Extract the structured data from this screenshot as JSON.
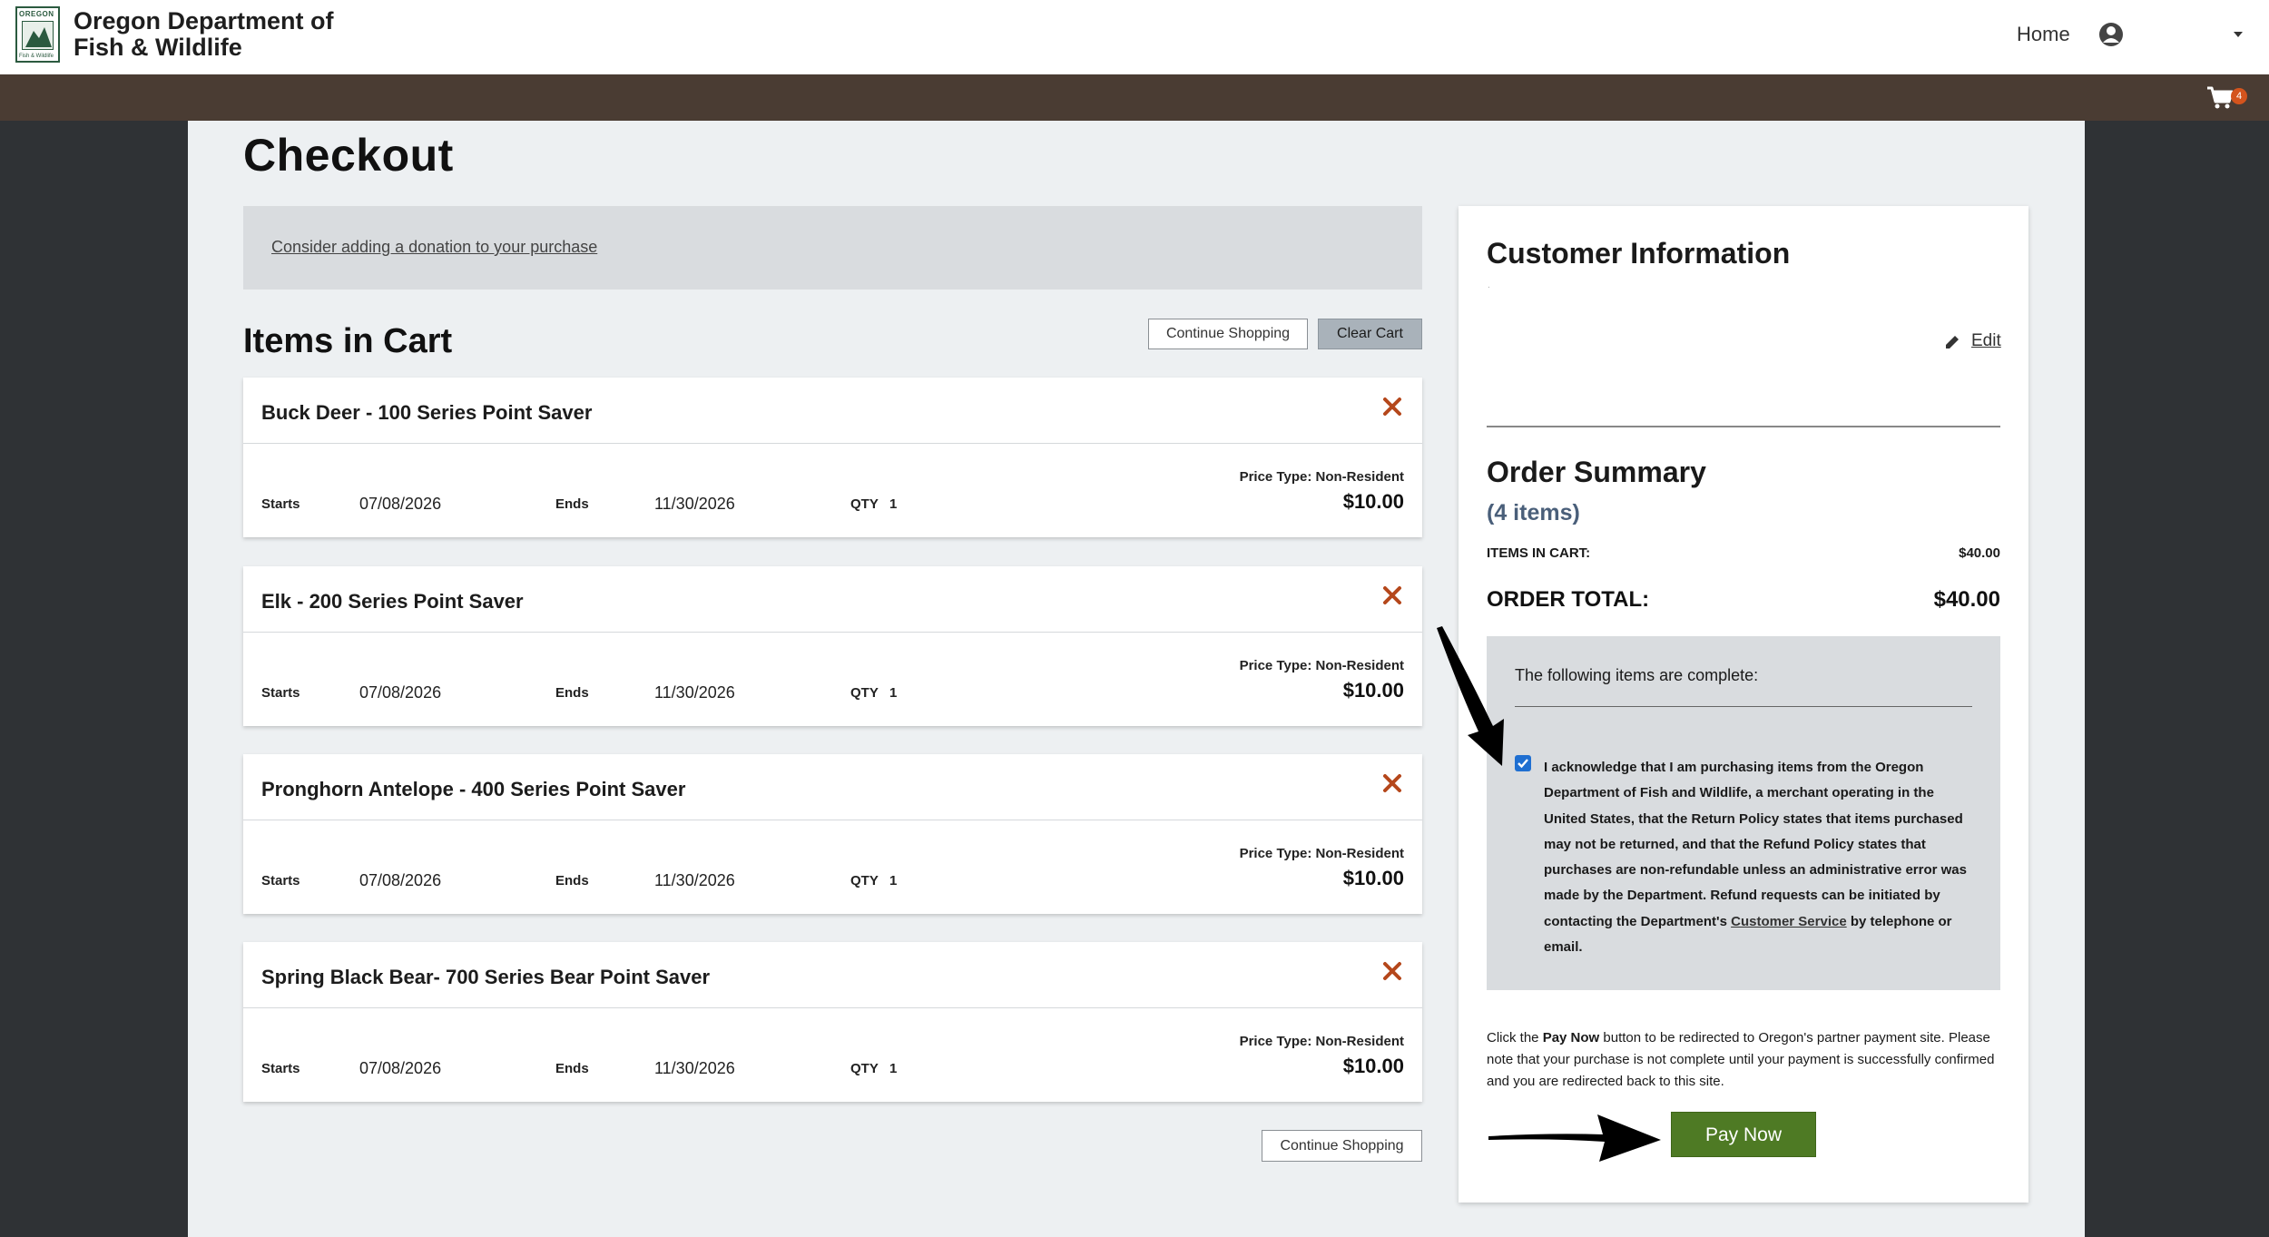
{
  "header": {
    "org_name": "Oregon Department of Fish & Wildlife",
    "logo_top": "OREGON",
    "logo_bottom": "Fish & Wildlife",
    "nav_home": "Home",
    "cart_count": "4"
  },
  "page": {
    "title": "Checkout",
    "donation_link": "Consider adding a donation to your purchase",
    "items_title": "Items in Cart",
    "continue_shopping": "Continue Shopping",
    "clear_cart": "Clear Cart"
  },
  "field_labels": {
    "starts": "Starts",
    "ends": "Ends",
    "qty": "QTY"
  },
  "cart_items": [
    {
      "name": "Buck Deer - 100 Series Point Saver",
      "starts": "07/08/2026",
      "ends": "11/30/2026",
      "qty": "1",
      "price_type": "Price Type: Non-Resident",
      "price": "$10.00"
    },
    {
      "name": "Elk - 200 Series Point Saver",
      "starts": "07/08/2026",
      "ends": "11/30/2026",
      "qty": "1",
      "price_type": "Price Type: Non-Resident",
      "price": "$10.00"
    },
    {
      "name": "Pronghorn Antelope - 400 Series Point Saver",
      "starts": "07/08/2026",
      "ends": "11/30/2026",
      "qty": "1",
      "price_type": "Price Type: Non-Resident",
      "price": "$10.00"
    },
    {
      "name": "Spring Black Bear- 700 Series Bear Point Saver",
      "starts": "07/08/2026",
      "ends": "11/30/2026",
      "qty": "1",
      "price_type": "Price Type: Non-Resident",
      "price": "$10.00"
    }
  ],
  "customer": {
    "title": "Customer Information",
    "placeholder_dot": ".",
    "edit": "Edit"
  },
  "summary": {
    "title": "Order Summary",
    "count": "(4 items)",
    "items_label": "ITEMS IN CART:",
    "items_value": "$40.00",
    "total_label": "ORDER TOTAL:",
    "total_value": "$40.00"
  },
  "ack": {
    "heading": "The following items are complete:",
    "checked": true,
    "text_before": "I acknowledge that I am purchasing items from the Oregon Department of Fish and Wildlife, a merchant operating in the United States, that the Return Policy states that items purchased may not be returned, and that the Refund Policy states that purchases are non-refundable unless an administrative error was made by the Department. Refund requests can be initiated by contacting the Department's",
    "link": "Customer Service",
    "text_after": "by telephone or email."
  },
  "payment": {
    "note_before": "Click the",
    "note_bold": "Pay Now",
    "note_after": "button to be redirected to Oregon's partner payment site. Please note that your purchase is not complete until your payment is successfully confirmed and you are redirected back to this site.",
    "pay_now": "Pay Now"
  },
  "colors": {
    "header_brown": "#4a3c33",
    "pay_green": "#4e7a24",
    "remove_orange": "#b5471b",
    "cart_badge": "#d4541d"
  }
}
